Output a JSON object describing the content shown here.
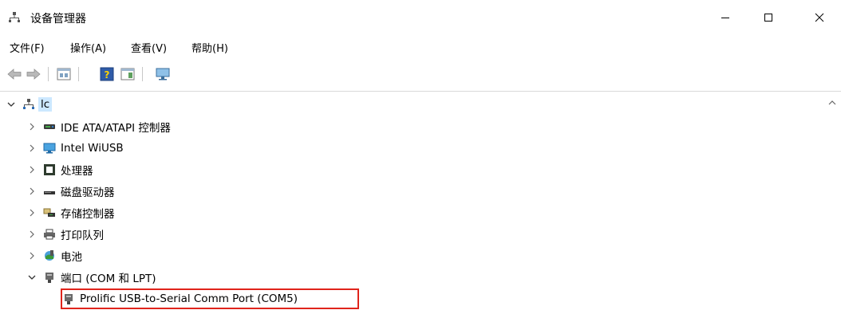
{
  "window": {
    "title": "设备管理器",
    "icons": {
      "app": "device-manager-icon",
      "minimize": "minimize-icon",
      "maximize": "maximize-icon",
      "close": "close-icon"
    }
  },
  "menu": {
    "items": [
      {
        "label": "文件(F)"
      },
      {
        "label": "操作(A)"
      },
      {
        "label": "查看(V)"
      },
      {
        "label": "帮助(H)"
      }
    ]
  },
  "toolbar": {
    "buttons": [
      "back-arrow-icon",
      "forward-arrow-icon",
      "properties-icon",
      "help-icon",
      "view-icon",
      "computer-scan-icon"
    ]
  },
  "tree": {
    "root": {
      "label": "lc",
      "icon": "computer-network-icon",
      "expanded": true
    },
    "nodes": [
      {
        "label": "IDE ATA/ATAPI 控制器",
        "icon": "ide-controller-icon",
        "expanded": false
      },
      {
        "label": "Intel WiUSB",
        "icon": "monitor-icon",
        "expanded": false
      },
      {
        "label": "处理器",
        "icon": "processor-icon",
        "expanded": false
      },
      {
        "label": "磁盘驱动器",
        "icon": "disk-drive-icon",
        "expanded": false
      },
      {
        "label": "存储控制器",
        "icon": "storage-controller-icon",
        "expanded": false
      },
      {
        "label": "打印队列",
        "icon": "printer-icon",
        "expanded": false
      },
      {
        "label": "电池",
        "icon": "battery-icon",
        "expanded": false
      },
      {
        "label": "端口 (COM 和 LPT)",
        "icon": "port-icon",
        "expanded": true
      }
    ],
    "child": {
      "label": "Prolific USB-to-Serial Comm Port (COM5)",
      "icon": "port-icon"
    }
  },
  "colors": {
    "selection": "#cce8ff",
    "highlight_border": "#e0241b"
  }
}
